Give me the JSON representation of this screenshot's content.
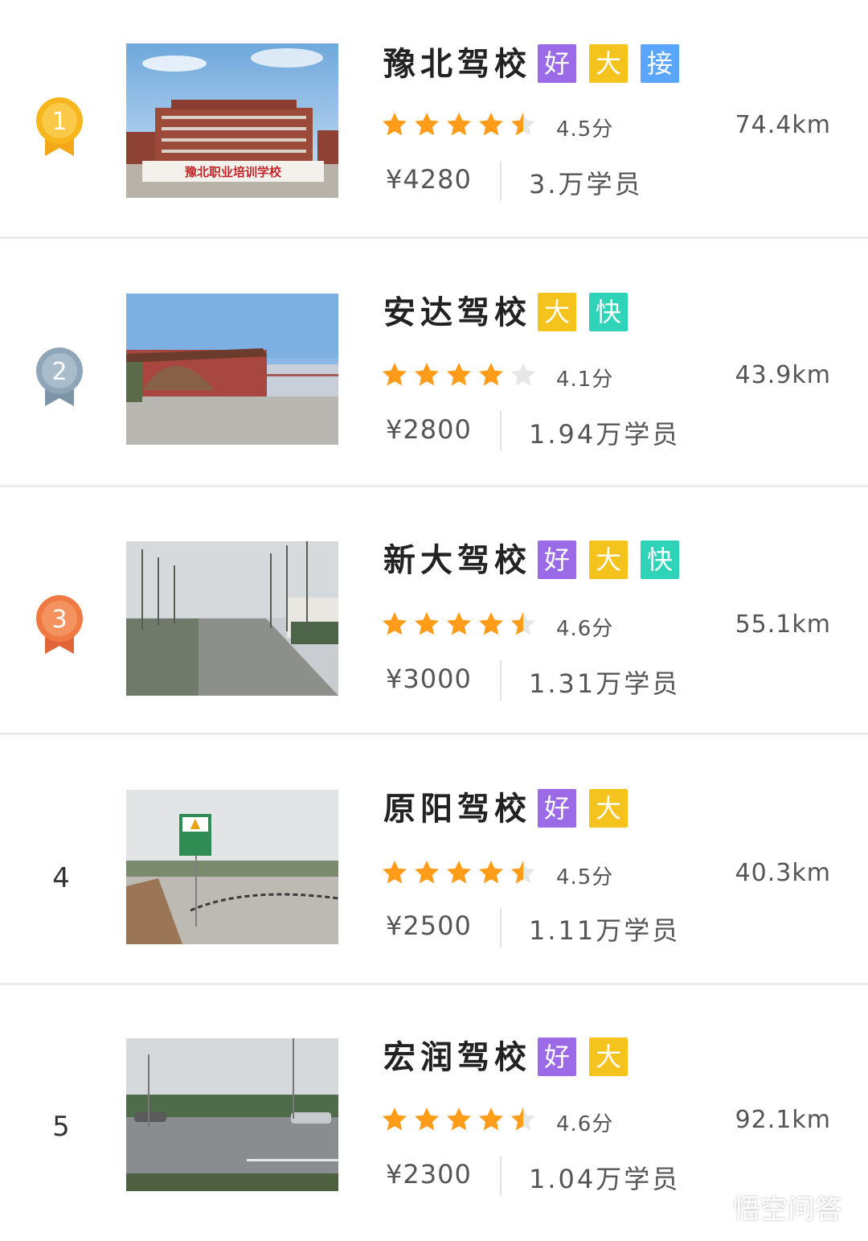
{
  "schools": [
    {
      "rank": "1",
      "medal": "gold",
      "name": "豫北驾校",
      "tags": [
        "好",
        "大",
        "接"
      ],
      "rating": 4.5,
      "score_text": "4.5分",
      "distance": "74.4km",
      "price": "¥4280",
      "students": "3.万学员",
      "photo": "豫北职业培训学校"
    },
    {
      "rank": "2",
      "medal": "silver",
      "name": "安达驾校",
      "tags": [
        "大",
        "快"
      ],
      "rating": 4.1,
      "score_text": "4.1分",
      "distance": "43.9km",
      "price": "¥2800",
      "students": "1.94万学员",
      "photo": ""
    },
    {
      "rank": "3",
      "medal": "bronze",
      "name": "新大驾校",
      "tags": [
        "好",
        "大",
        "快"
      ],
      "rating": 4.6,
      "score_text": "4.6分",
      "distance": "55.1km",
      "price": "¥3000",
      "students": "1.31万学员",
      "photo": ""
    },
    {
      "rank": "4",
      "medal": "",
      "name": "原阳驾校",
      "tags": [
        "好",
        "大"
      ],
      "rating": 4.5,
      "score_text": "4.5分",
      "distance": "40.3km",
      "price": "¥2500",
      "students": "1.11万学员",
      "photo": ""
    },
    {
      "rank": "5",
      "medal": "",
      "name": "宏润驾校",
      "tags": [
        "好",
        "大"
      ],
      "rating": 4.6,
      "score_text": "4.6分",
      "distance": "92.1km",
      "price": "¥2300",
      "students": "1.04万学员",
      "photo": ""
    }
  ],
  "colors": {
    "star_on": "#ff9c1a",
    "star_off": "#e6e6e6",
    "gold": "#f7b51e",
    "silver": "#8fa6b8",
    "bronze": "#ef7a44",
    "tag_hao": "#9b6ae6",
    "tag_da": "#f5c31e",
    "tag_jie": "#5aa6ff",
    "tag_kuai": "#2ed3b8"
  },
  "watermark": {
    "icon": "chat-bubbles-icon",
    "text": "悟空问答"
  }
}
